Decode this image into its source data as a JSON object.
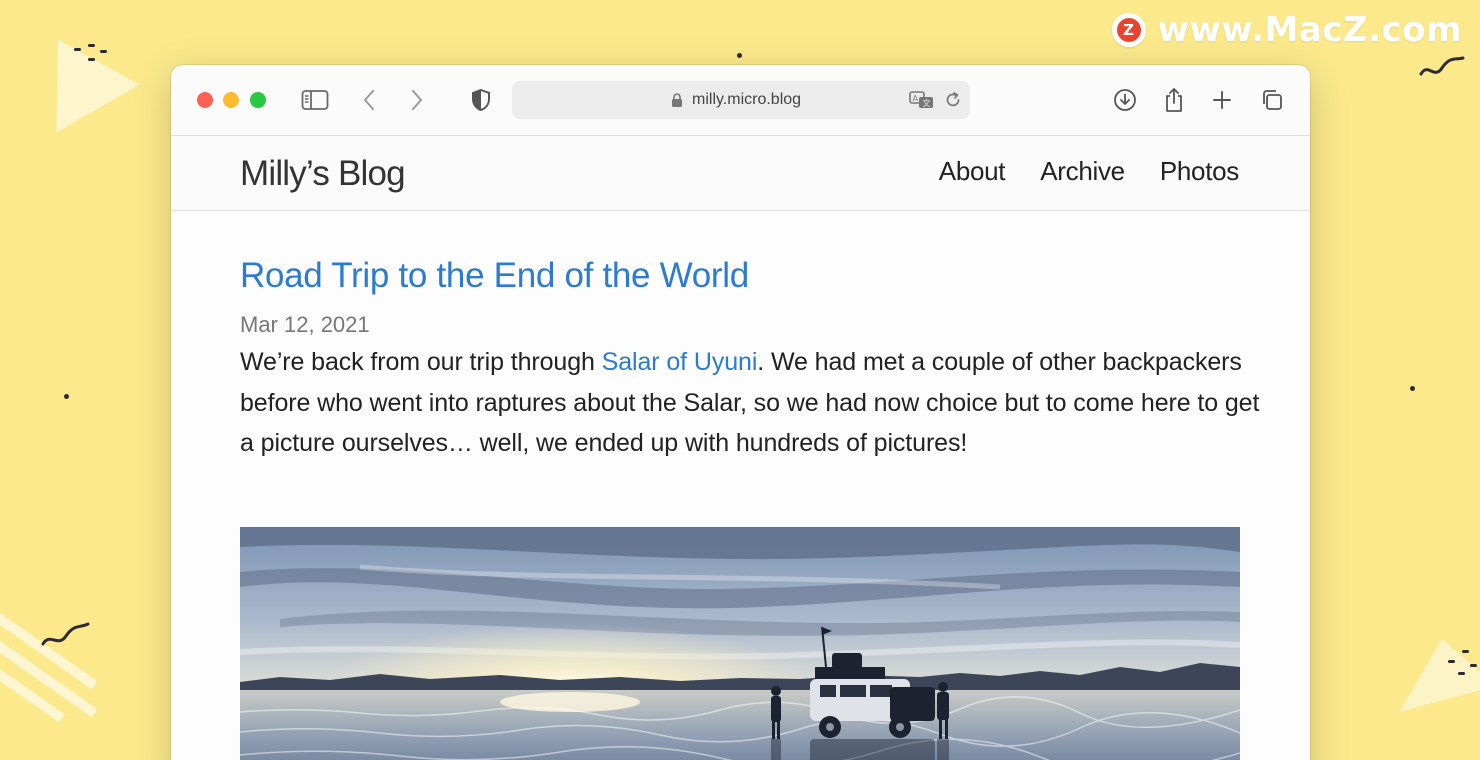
{
  "watermark": {
    "logo_letter": "Z",
    "text": "www.MacZ.com"
  },
  "browser": {
    "address": "milly.micro.blog"
  },
  "site": {
    "title": "Milly’s Blog",
    "nav": [
      "About",
      "Archive",
      "Photos"
    ]
  },
  "post": {
    "title": "Road Trip to the End of the World",
    "date": "Mar 12, 2021",
    "body_before_link": "We’re back from our trip through ",
    "link_text": "Salar of Uyuni",
    "body_after_link": ". We had met a couple of other backpackers before who went into raptures about the Salar, so we had now choice but to come here to get a picture ourselves… well, we ended up with hundreds of pictures!"
  },
  "colors": {
    "background": "#fbe98c",
    "link": "#2b7bd1",
    "traffic_close": "#fe5f57",
    "traffic_minimize": "#febc2e",
    "traffic_maximize": "#28c840"
  },
  "icons": {
    "toolbar": [
      "sidebar-icon",
      "back-icon",
      "forward-icon",
      "privacy-shield-icon",
      "lock-icon",
      "translate-icon",
      "reload-icon",
      "download-icon",
      "share-icon",
      "new-tab-icon",
      "tab-overview-icon"
    ]
  }
}
